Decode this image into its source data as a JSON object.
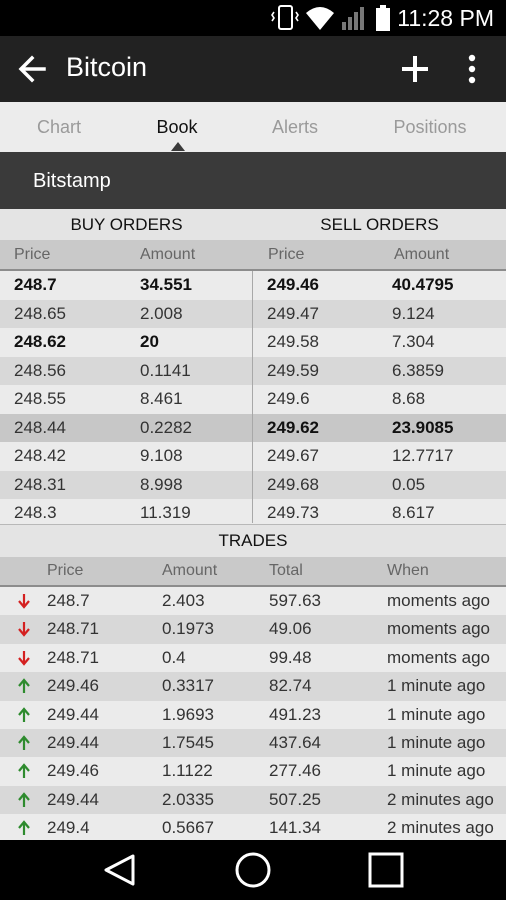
{
  "status_bar": {
    "time": "11:28 PM"
  },
  "app_bar": {
    "title": "Bitcoin"
  },
  "tabs": [
    {
      "label": "Chart",
      "active": false
    },
    {
      "label": "Book",
      "active": true
    },
    {
      "label": "Alerts",
      "active": false
    },
    {
      "label": "Positions",
      "active": false
    }
  ],
  "exchange": "Bitstamp",
  "book": {
    "buy_header": "BUY ORDERS",
    "sell_header": "SELL ORDERS",
    "columns": [
      "Price",
      "Amount",
      "Price",
      "Amount"
    ],
    "rows": [
      {
        "buy_price": "248.7",
        "buy_amount": "34.551",
        "buy_bold": true,
        "sell_price": "249.46",
        "sell_amount": "40.4795",
        "sell_bold": true
      },
      {
        "buy_price": "248.65",
        "buy_amount": "2.008",
        "buy_bold": false,
        "sell_price": "249.47",
        "sell_amount": "9.124",
        "sell_bold": false
      },
      {
        "buy_price": "248.62",
        "buy_amount": "20",
        "buy_bold": true,
        "sell_price": "249.58",
        "sell_amount": "7.304",
        "sell_bold": false
      },
      {
        "buy_price": "248.56",
        "buy_amount": "0.1141",
        "buy_bold": false,
        "sell_price": "249.59",
        "sell_amount": "6.3859",
        "sell_bold": false
      },
      {
        "buy_price": "248.55",
        "buy_amount": "8.461",
        "buy_bold": false,
        "sell_price": "249.6",
        "sell_amount": "8.68",
        "sell_bold": false
      },
      {
        "buy_price": "248.44",
        "buy_amount": "0.2282",
        "buy_bold": false,
        "sell_price": "249.62",
        "sell_amount": "23.9085",
        "sell_bold": true
      },
      {
        "buy_price": "248.42",
        "buy_amount": "9.108",
        "buy_bold": false,
        "sell_price": "249.67",
        "sell_amount": "12.7717",
        "sell_bold": false
      },
      {
        "buy_price": "248.31",
        "buy_amount": "8.998",
        "buy_bold": false,
        "sell_price": "249.68",
        "sell_amount": "0.05",
        "sell_bold": false
      },
      {
        "buy_price": "248.3",
        "buy_amount": "11.319",
        "buy_bold": false,
        "sell_price": "249.73",
        "sell_amount": "8.617",
        "sell_bold": false
      }
    ]
  },
  "trades": {
    "header": "TRADES",
    "columns": [
      "Price",
      "Amount",
      "Total",
      "When"
    ],
    "rows": [
      {
        "dir": "down",
        "price": "248.7",
        "amount": "2.403",
        "total": "597.63",
        "when": "moments ago"
      },
      {
        "dir": "down",
        "price": "248.71",
        "amount": "0.1973",
        "total": "49.06",
        "when": "moments ago"
      },
      {
        "dir": "down",
        "price": "248.71",
        "amount": "0.4",
        "total": "99.48",
        "when": "moments ago"
      },
      {
        "dir": "up",
        "price": "249.46",
        "amount": "0.3317",
        "total": "82.74",
        "when": "1 minute ago"
      },
      {
        "dir": "up",
        "price": "249.44",
        "amount": "1.9693",
        "total": "491.23",
        "when": "1 minute ago"
      },
      {
        "dir": "up",
        "price": "249.44",
        "amount": "1.7545",
        "total": "437.64",
        "when": "1 minute ago"
      },
      {
        "dir": "up",
        "price": "249.46",
        "amount": "1.1122",
        "total": "277.46",
        "when": "1 minute ago"
      },
      {
        "dir": "up",
        "price": "249.44",
        "amount": "2.0335",
        "total": "507.25",
        "when": "2 minutes ago"
      },
      {
        "dir": "up",
        "price": "249.4",
        "amount": "0.5667",
        "total": "141.34",
        "when": "2 minutes ago"
      }
    ]
  },
  "colors": {
    "up_arrow": "#2e8b2e",
    "down_arrow": "#d42020"
  }
}
